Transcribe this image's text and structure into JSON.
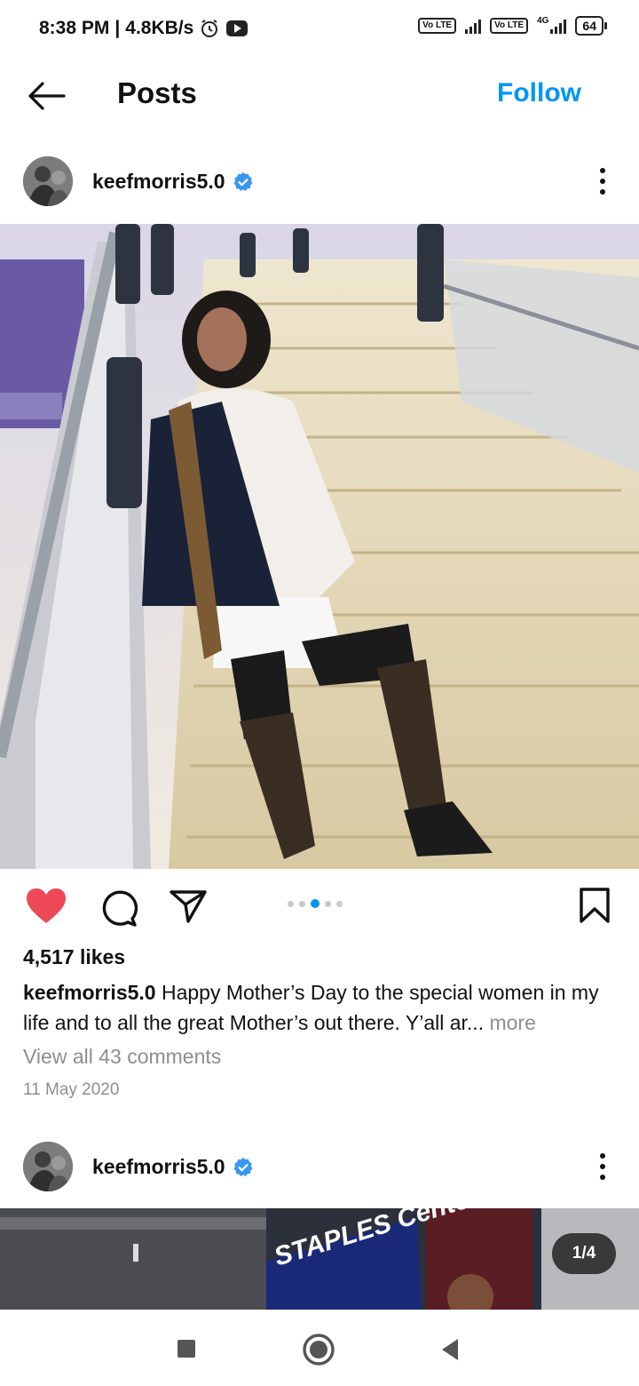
{
  "status_bar": {
    "time": "8:38 PM",
    "separator": "|",
    "speed": "4.8KB/s",
    "sim1": "Vo LTE",
    "sim2": "Vo LTE",
    "network": "4G",
    "battery": "64",
    "icons": [
      "alarm-icon",
      "youtube-icon",
      "signal-icon",
      "battery-icon"
    ]
  },
  "header": {
    "title": "Posts",
    "follow_label": "Follow",
    "back_icon": "arrow-left-icon"
  },
  "colors": {
    "accent": "#0095f6",
    "like": "#ed4956",
    "muted": "#8e8e8e"
  },
  "post": {
    "username": "keefmorris5.0",
    "likes": "4,517 likes",
    "caption_user": "keefmorris5.0",
    "caption_text": " Happy Mother’s Day to the special women in my life and to all the great Mother’s out there. Y’all ar",
    "caption_ellipsis": "...",
    "more_label": " more",
    "comments_label": "View all 43 comments",
    "date": "11 May 2020",
    "carousel_active": 3,
    "carousel_count": 5
  },
  "post2": {
    "username": "keefmorris5.0",
    "counter": "1/4",
    "sign_text": "STAPLES Center"
  },
  "nav": {
    "buttons": [
      "recent-apps-icon",
      "home-icon",
      "back-icon"
    ]
  }
}
